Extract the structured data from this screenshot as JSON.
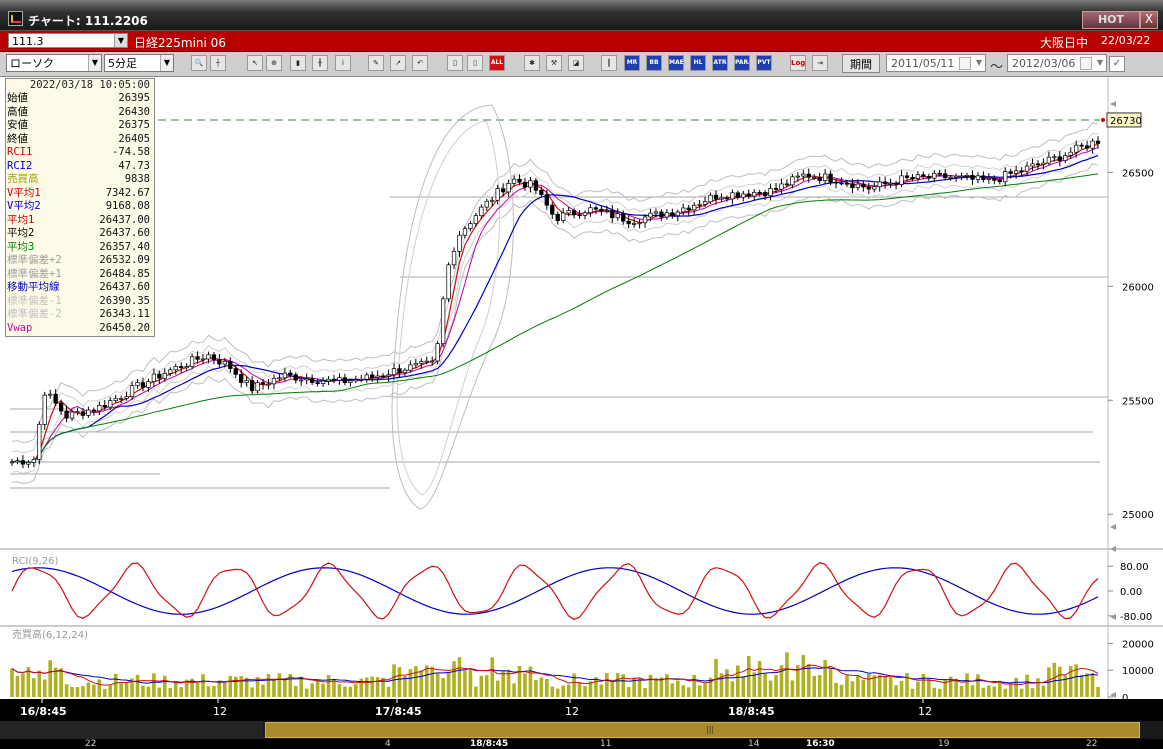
{
  "window": {
    "title": "チャート: 111.2206",
    "hot_label": "HOT",
    "close_label": "X"
  },
  "symbol_bar": {
    "code": "111.3",
    "name": "日経225mini 06",
    "market": "大阪日中",
    "date": "22/03/22"
  },
  "toolbar": {
    "chart_type": "ローソク",
    "interval": "5分足",
    "period_label": "期間",
    "from_date": "2011/05/11",
    "to_date": "2012/03/06",
    "tilde": "〜",
    "buttons": [
      "MR",
      "BB",
      "MAE",
      "HL",
      "ATR",
      "PARA",
      "PVT",
      "Log"
    ]
  },
  "info_panel": {
    "timestamp": "2022/03/18 10:05:00",
    "rows": [
      {
        "label": "始値",
        "value": "26395",
        "color": "#000000"
      },
      {
        "label": "高値",
        "value": "26430",
        "color": "#000000"
      },
      {
        "label": "安値",
        "value": "26375",
        "color": "#000000"
      },
      {
        "label": "終値",
        "value": "26405",
        "color": "#000000"
      },
      {
        "label": "RCI1",
        "value": "-74.58",
        "color": "#d00000"
      },
      {
        "label": "RCI2",
        "value": "47.73",
        "color": "#0000c0"
      },
      {
        "label": "売買高",
        "value": "9838",
        "color": "#a0a000"
      },
      {
        "label": "V平均1",
        "value": "7342.67",
        "color": "#d00000"
      },
      {
        "label": "V平均2",
        "value": "9168.08",
        "color": "#0000c0"
      },
      {
        "label": "平均1",
        "value": "26437.00",
        "color": "#d00000"
      },
      {
        "label": "平均2",
        "value": "26437.60",
        "color": "#000000"
      },
      {
        "label": "平均3",
        "value": "26357.40",
        "color": "#008000"
      },
      {
        "label": "標準偏差+2",
        "value": "26532.09",
        "color": "#a0a0a0"
      },
      {
        "label": "標準偏差+1",
        "value": "26484.85",
        "color": "#a0a0a0"
      },
      {
        "label": "移動平均線",
        "value": "26437.60",
        "color": "#0000c0"
      },
      {
        "label": "標準偏差-1",
        "value": "26390.35",
        "color": "#c0c0c0"
      },
      {
        "label": "標準偏差-2",
        "value": "26343.11",
        "color": "#c0c0c0"
      },
      {
        "label": "Vwap",
        "value": "26450.20",
        "color": "#d000a0"
      }
    ]
  },
  "price_axis": {
    "ticks": [
      "26500",
      "26000",
      "25500",
      "25000"
    ],
    "current_price": "26730"
  },
  "rci_panel": {
    "label": "RCI(9,26)",
    "ticks": [
      "80.00",
      "0.00",
      "-80.00"
    ]
  },
  "volume_panel": {
    "label": "売買高(6,12,24)",
    "ticks": [
      "20000",
      "10000",
      "0"
    ]
  },
  "time_axis": [
    "16/8:45",
    "12",
    "17/8:45",
    "12",
    "18/8:45",
    "12"
  ],
  "timeline": [
    "22",
    "4",
    "18/8:45",
    "11",
    "14",
    "16:30",
    "19",
    "22"
  ],
  "chart_data": {
    "type": "candlestick",
    "price_range": [
      24900,
      26800
    ],
    "current_price": 26730,
    "rci_range": [
      -100,
      100
    ],
    "volume_range": [
      0,
      25000
    ]
  }
}
